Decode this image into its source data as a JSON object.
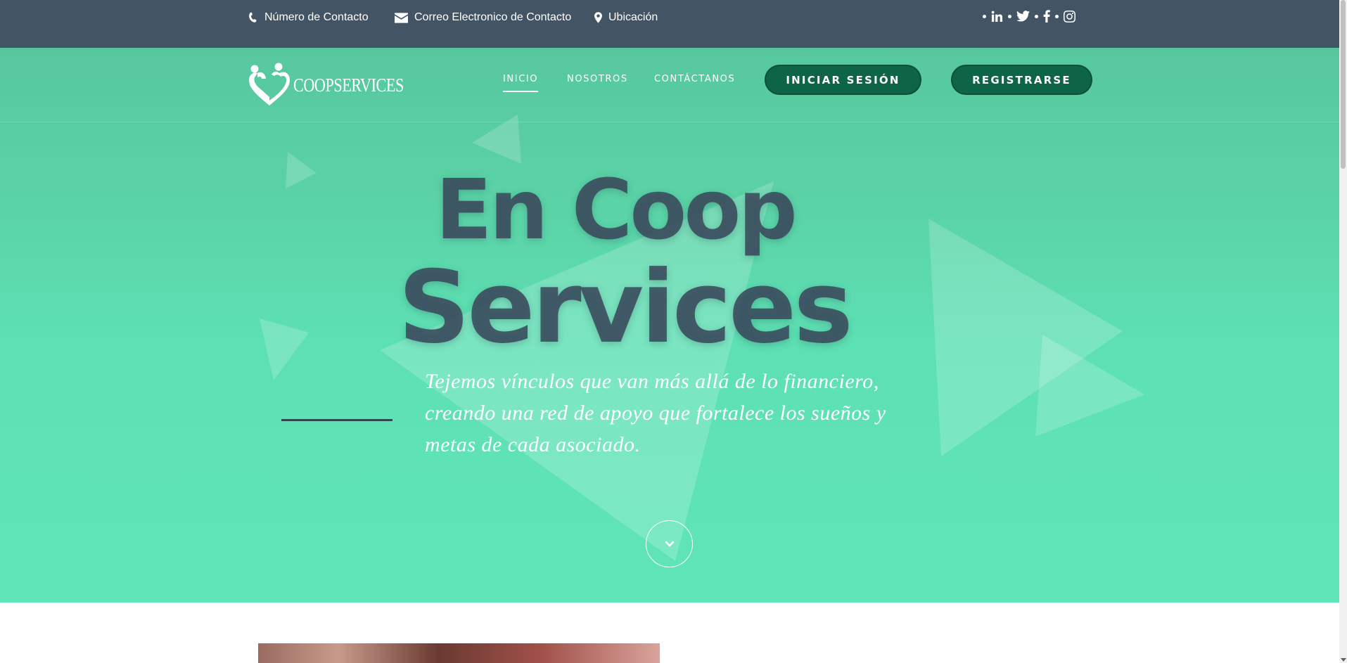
{
  "topbar": {
    "phone_label": "Número de Contacto",
    "email_label": "Correo Electronico de Contacto",
    "location_label": "Ubicación",
    "socials": [
      "linkedin-icon",
      "twitter-icon",
      "facebook-icon",
      "instagram-icon"
    ]
  },
  "brand": {
    "logo_text": "COOPSERVICES"
  },
  "nav": {
    "items": [
      {
        "label": "INICIO",
        "active": true
      },
      {
        "label": "NOSOTROS",
        "active": false
      },
      {
        "label": "CONTÁCTANOS",
        "active": false
      }
    ],
    "login_label": "INICIAR SESIÓN",
    "register_label": "REGISTRARSE"
  },
  "hero": {
    "headline_line1": "En Coop",
    "headline_line2": "Services",
    "subtitle": "Tejemos vínculos que van más allá de lo financiero, creando una red de apoyo que fortalece los sueños y metas de cada asociado.",
    "scroll_icon": "chevron-down-icon"
  },
  "colors": {
    "topbar_bg": "#435565",
    "hero_green": "#5fe5b8",
    "button_green": "#0e6447",
    "headline": "#3a4a5c"
  }
}
